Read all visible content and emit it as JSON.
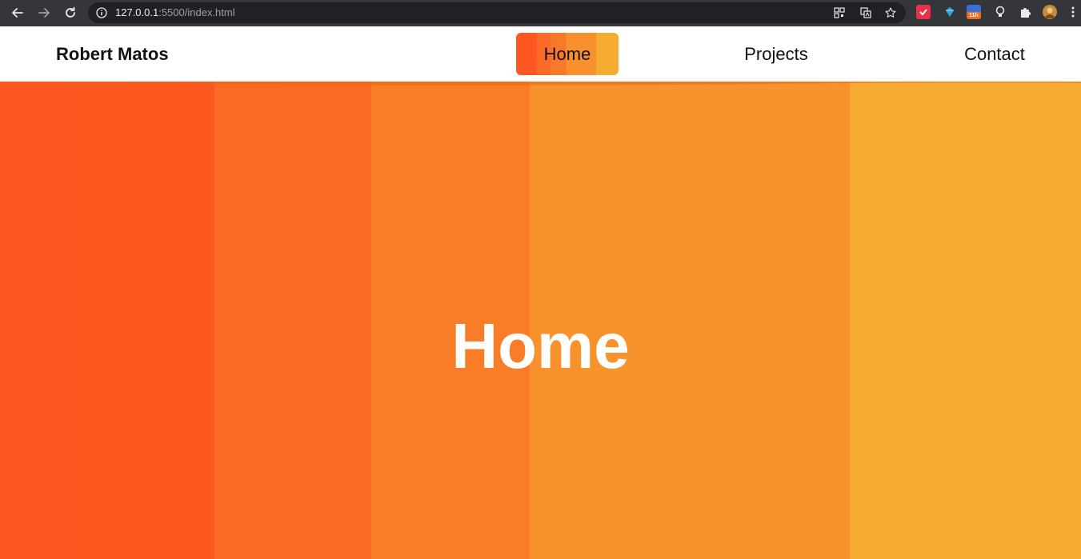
{
  "browser": {
    "url_host": "127.0.0.1",
    "url_path": ":5500/index.html",
    "extensions": [
      {
        "name": "todo-extension-icon",
        "color": "#e8304a"
      },
      {
        "name": "gem-extension-icon",
        "color": "#2aa9e0"
      },
      {
        "name": "calendar-extension-icon",
        "color": "#3a6fd8",
        "label": "11h"
      },
      {
        "name": "bulb-extension-icon",
        "color": "#e8eaed"
      },
      {
        "name": "puzzle-extension-icon",
        "color": "#e8eaed"
      }
    ]
  },
  "header": {
    "brand": "Robert Matos",
    "nav": [
      {
        "label": "Home",
        "active": true
      },
      {
        "label": "Projects",
        "active": false
      },
      {
        "label": "Contact",
        "active": false
      }
    ]
  },
  "hero": {
    "title": "Home",
    "colors": [
      "#ff5722",
      "#fb6a24",
      "#f97c27",
      "#f8922c",
      "#f6aa31"
    ]
  }
}
